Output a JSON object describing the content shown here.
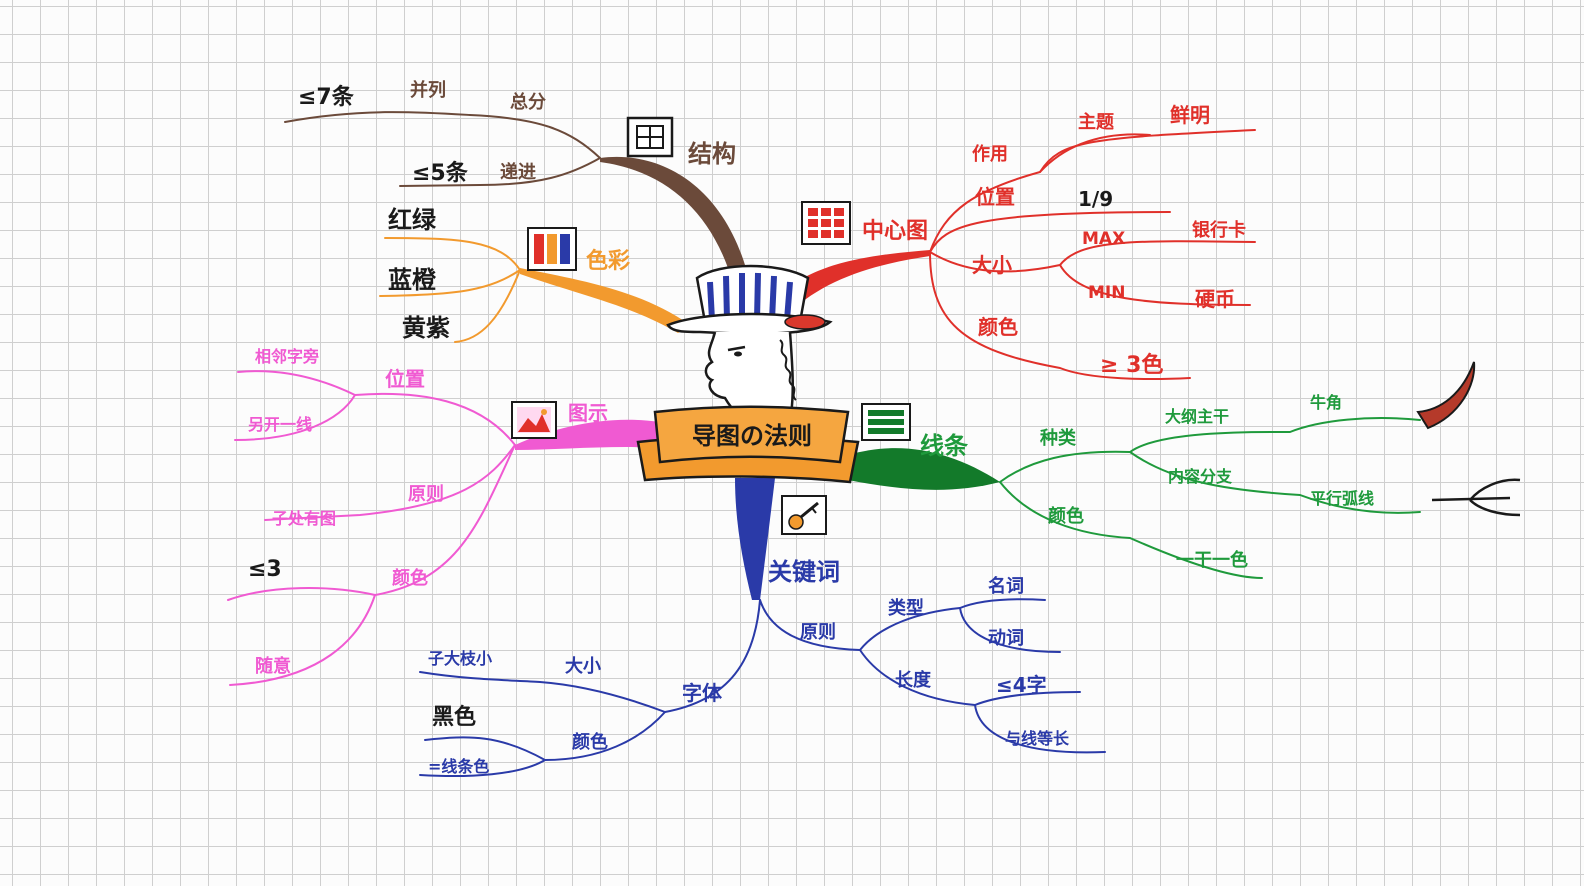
{
  "colors": {
    "structure": "#6b4a3a",
    "center": "#e0302a",
    "color_branch": "#f29a2e",
    "line": "#1f9a3c",
    "line_dark": "#137a2a",
    "image": "#f05ad2",
    "keyword": "#2a3aa8",
    "black": "#1a1a1a"
  },
  "center": {
    "banner": "导图の法则"
  },
  "structure": {
    "label": "结构",
    "sub1": "总分",
    "sub1_a": "并列",
    "sub1_b": "≤7条",
    "sub2": "递进",
    "sub2_a": "≤5条"
  },
  "color_branch": {
    "label": "色彩",
    "items": [
      "红绿",
      "蓝橙",
      "黄紫"
    ]
  },
  "center_image": {
    "label": "中心图",
    "role": "作用",
    "role_a": "主题",
    "role_b": "鲜明",
    "position": "位置",
    "position_v": "1/9",
    "size": "大小",
    "size_max": "MAX",
    "size_max_v": "银行卡",
    "size_min": "MIN",
    "size_min_v": "硬币",
    "color": "颜色",
    "color_v": "≥ 3色"
  },
  "lines": {
    "label": "线条",
    "kind": "种类",
    "kind_a": "大纲主干",
    "kind_a_v": "牛角",
    "kind_b": "内容分支",
    "kind_b_v": "平行弧线",
    "color": "颜色",
    "color_v": "一干一色"
  },
  "image_branch": {
    "label": "图示",
    "position": "位置",
    "position_a": "相邻字旁",
    "position_b": "另开一线",
    "principle": "原则",
    "principle_v": "子处有图",
    "color": "颜色",
    "color_a": "≤3",
    "color_b": "随意"
  },
  "keyword": {
    "label": "关键词",
    "principle": "原则",
    "type": "类型",
    "type_a": "名词",
    "type_b": "动词",
    "length": "长度",
    "length_a": "≤4字",
    "length_b": "与线等长",
    "font": "字体",
    "font_size": "大小",
    "font_size_v": "子大枝小",
    "font_color": "颜色",
    "font_color_a": "黑色",
    "font_color_b": "=线条色"
  }
}
